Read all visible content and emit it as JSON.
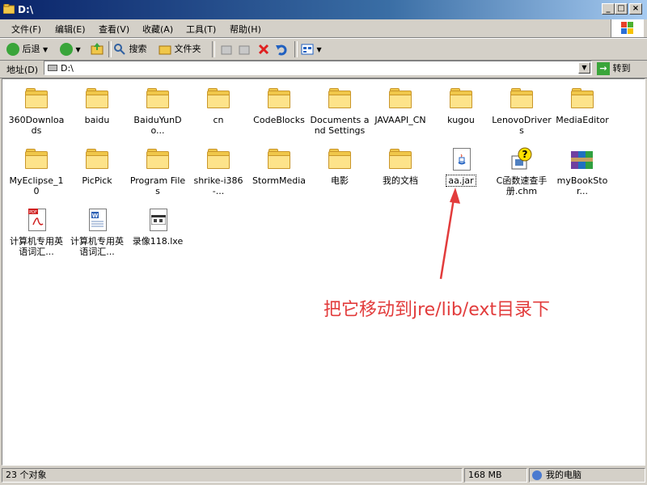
{
  "window": {
    "title": "D:\\"
  },
  "title_buttons": [
    "_",
    "□",
    "×"
  ],
  "menu": [
    "文件(F)",
    "编辑(E)",
    "查看(V)",
    "收藏(A)",
    "工具(T)",
    "帮助(H)"
  ],
  "toolbar": {
    "back": "后退",
    "search": "搜索",
    "folders": "文件夹"
  },
  "address": {
    "label": "地址(D)",
    "value": "D:\\",
    "go": "转到"
  },
  "items": [
    {
      "label": "360Downloads",
      "type": "folder"
    },
    {
      "label": "baidu",
      "type": "folder"
    },
    {
      "label": "BaiduYunDo...",
      "type": "folder"
    },
    {
      "label": "cn",
      "type": "folder"
    },
    {
      "label": "CodeBlocks",
      "type": "folder"
    },
    {
      "label": "Documents and Settings",
      "type": "folder"
    },
    {
      "label": "JAVAAPI_CN",
      "type": "folder"
    },
    {
      "label": "kugou",
      "type": "folder"
    },
    {
      "label": "LenovoDrivers",
      "type": "folder"
    },
    {
      "label": "MediaEditor",
      "type": "folder"
    },
    {
      "label": "MyEclipse_10",
      "type": "folder"
    },
    {
      "label": "PicPick",
      "type": "folder"
    },
    {
      "label": "Program Files",
      "type": "folder"
    },
    {
      "label": "shrike-i386-...",
      "type": "folder"
    },
    {
      "label": "StormMedia",
      "type": "folder"
    },
    {
      "label": "电影",
      "type": "folder"
    },
    {
      "label": "我的文档",
      "type": "folder"
    },
    {
      "label": "aa.jar",
      "type": "jar"
    },
    {
      "label": "C函数速查手册.chm",
      "type": "chm"
    },
    {
      "label": "myBookStor...",
      "type": "rar"
    },
    {
      "label": "计算机专用英语词汇...",
      "type": "pdf"
    },
    {
      "label": "计算机专用英语词汇...",
      "type": "word"
    },
    {
      "label": "录像118.lxe",
      "type": "lxe"
    }
  ],
  "annotation": "把它移动到jre/lib/ext目录下",
  "status": {
    "count": "23 个对象",
    "size": "168 MB",
    "location": "我的电脑"
  },
  "colors": {
    "annotation": "#e23c3c",
    "folder": "#f0c74a",
    "titlebar": "#0a246a"
  }
}
